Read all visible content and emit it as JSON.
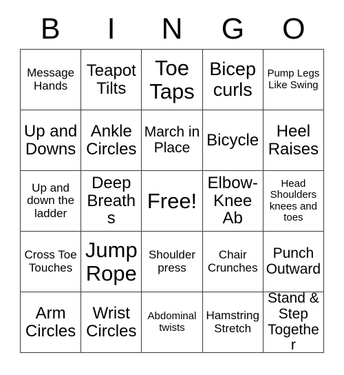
{
  "card": {
    "header_letters": [
      "B",
      "I",
      "N",
      "G",
      "O"
    ],
    "rows": [
      [
        {
          "text": "Message Hands",
          "size": "sm"
        },
        {
          "text": "Teapot Tilts",
          "size": "lg"
        },
        {
          "text": "Toe Taps",
          "size": "xxl"
        },
        {
          "text": "Bicep curls",
          "size": "xl"
        },
        {
          "text": "Pump Legs Like Swing",
          "size": "xs"
        }
      ],
      [
        {
          "text": "Up and Downs",
          "size": "lg"
        },
        {
          "text": "Ankle Circles",
          "size": "lg"
        },
        {
          "text": "March in Place",
          "size": "md"
        },
        {
          "text": "Bicycle",
          "size": "lg"
        },
        {
          "text": "Heel Raises",
          "size": "lg"
        }
      ],
      [
        {
          "text": "Up and down the ladder",
          "size": "sm"
        },
        {
          "text": "Deep Breaths",
          "size": "lg"
        },
        {
          "text": "Free!",
          "size": "xxl"
        },
        {
          "text": "Elbow-Knee Ab",
          "size": "lg"
        },
        {
          "text": "Head Shoulders knees and toes",
          "size": "xs"
        }
      ],
      [
        {
          "text": "Cross Toe Touches",
          "size": "sm"
        },
        {
          "text": "Jump Rope",
          "size": "xxl"
        },
        {
          "text": "Shoulder press",
          "size": "sm"
        },
        {
          "text": "Chair Crunches",
          "size": "sm"
        },
        {
          "text": "Punch Outward",
          "size": "md"
        }
      ],
      [
        {
          "text": "Arm Circles",
          "size": "lg"
        },
        {
          "text": "Wrist Circles",
          "size": "lg"
        },
        {
          "text": "Abdominal twists",
          "size": "xs"
        },
        {
          "text": "Hamstring Stretch",
          "size": "sm"
        },
        {
          "text": "Stand & Step Together",
          "size": "md"
        }
      ]
    ],
    "colors": {
      "background": "#ffffff",
      "text": "#000000",
      "grid_line": "#3a3a3a"
    }
  }
}
